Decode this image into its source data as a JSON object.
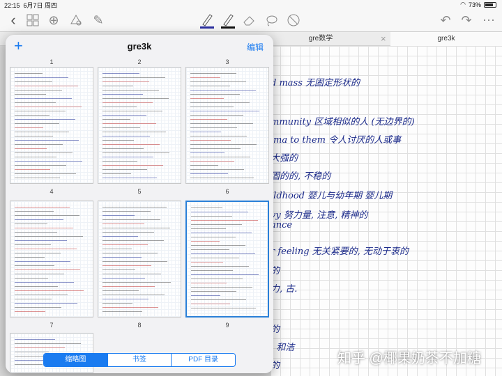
{
  "status": {
    "time": "22:15",
    "date": "6月7日 周四",
    "battery": "73%"
  },
  "tabs": [
    {
      "label": "gre数学"
    },
    {
      "label": "gre3k"
    }
  ],
  "popover": {
    "title": "gre3k",
    "edit_label": "编辑",
    "add_label": "+",
    "pages": [
      "1",
      "2",
      "3",
      "4",
      "5",
      "6",
      "7",
      "8",
      "9"
    ],
    "segments": [
      {
        "label": "缩略图"
      },
      {
        "label": "书签"
      },
      {
        "label": "PDF 目录"
      }
    ]
  },
  "note": {
    "lines": [
      "d mass   无固定形状的",
      "mmunity  区域相似的人 (无边界的)",
      "ma to  them  令人讨厌的人或事",
      "大强的",
      "固的的, 不稳的",
      "ildhood   婴儿与幼年期 婴儿期",
      "vy  努力量, 注意, 精神的",
      "ance",
      "r feeling  无关紧要的, 无动于衷的",
      "的",
      "力, 古.",
      "的",
      ", 和洁",
      "的"
    ]
  },
  "watermark": "知乎 @椰果奶茶不加糖"
}
